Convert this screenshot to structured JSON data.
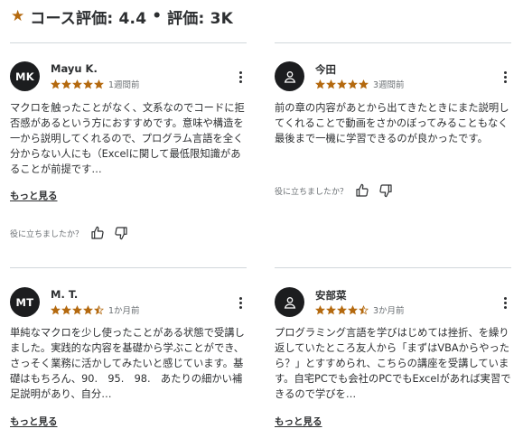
{
  "header": {
    "star_icon": "star-icon",
    "course_rating": "コース評価: 4.4",
    "separator": "•",
    "rating_count": "評価: 3K"
  },
  "colors": {
    "star": "#b4690e",
    "text": "#2d2f31",
    "muted": "#6a6f73",
    "divider": "#d1d7dc"
  },
  "reviews": [
    {
      "initials": "MK",
      "name": "Mayu K.",
      "rating": 5,
      "time": "1週間前",
      "text": "マクロを触ったことがなく、文系なのでコードに拒否感があるという方におすすめです。意味や構造を一から説明してくれるので、プログラム言語を全く分からない人にも（Excelに関して最低限知識があることが前提です…",
      "more": "もっと見る",
      "helpful": "役に立ちましたか？"
    },
    {
      "initials": "",
      "name": "今田",
      "rating": 5,
      "time": "3週間前",
      "text": "前の章の内容があとから出てきたときにまた説明してくれることで動画をさかのぼってみることもなく最後まで一機に学習できるのが良かったです。",
      "more": "",
      "helpful": "役に立ちましたか？"
    },
    {
      "initials": "MT",
      "name": "M. T.",
      "rating": 4.5,
      "time": "1か月前",
      "text": "単純なマクロを少し使ったことがある状態で受講しました。実践的な内容を基礎から学ぶことができ、さっそく業務に活かしてみたいと感じています。基礎はもちろん、90.　95.　98.　あたりの細かい補足説明があり、自分…",
      "more": "もっと見る",
      "helpful": ""
    },
    {
      "initials": "",
      "name": "安部菜",
      "rating": 4.5,
      "time": "3か月前",
      "text": "プログラミング言語を学びはじめては挫折、を繰り返していたところ友人から「まずはVBAからやったら？」とすすめられ、こちらの講座を受講しています。自宅PCでも会社のPCでもExcelがあれば実習できるので学びを…",
      "more": "もっと見る",
      "helpful": ""
    }
  ]
}
